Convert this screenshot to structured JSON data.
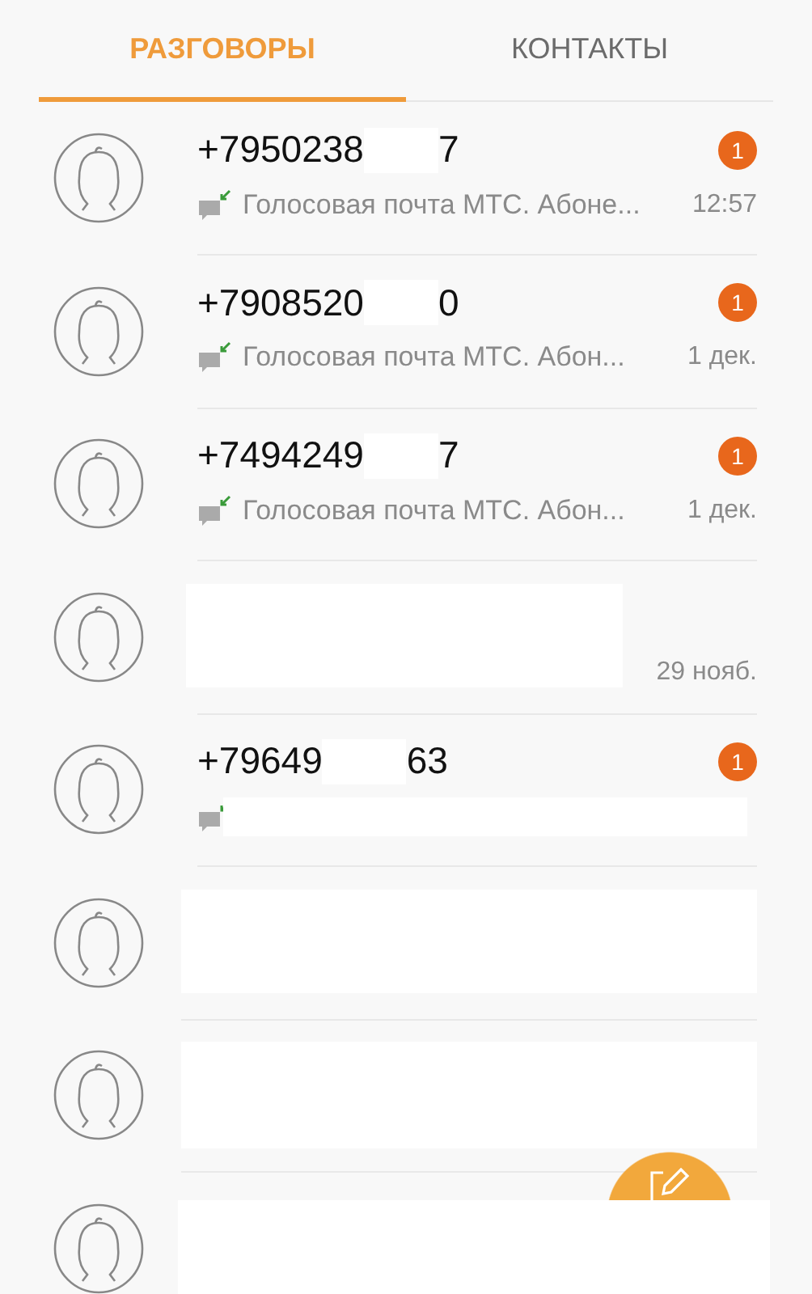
{
  "tabs": [
    {
      "label": "РАЗГОВОРЫ",
      "selected": true
    },
    {
      "label": "КОНТАКТЫ",
      "selected": false
    }
  ],
  "conversations": [
    {
      "kind": "full",
      "number": [
        "+7950238",
        "7"
      ],
      "preview": "Голосовая почта МТС. Абоне...",
      "time": "12:57",
      "unread": "1"
    },
    {
      "kind": "full",
      "number": [
        "+7908520",
        "0"
      ],
      "preview": "Голосовая почта МТС. Абон...",
      "time": "1 дек.",
      "unread": "1"
    },
    {
      "kind": "full",
      "number": [
        "+7494249",
        "7"
      ],
      "preview": "Голосовая почта МТС. Абон...",
      "time": "1 дек.",
      "unread": "1"
    },
    {
      "kind": "hidden_name",
      "time": "29 нояб."
    },
    {
      "kind": "hidden_preview",
      "number": [
        "+79649",
        "63"
      ],
      "unread": "1"
    },
    {
      "kind": "hidden"
    },
    {
      "kind": "hidden"
    },
    {
      "kind": "hidden_cut"
    }
  ]
}
